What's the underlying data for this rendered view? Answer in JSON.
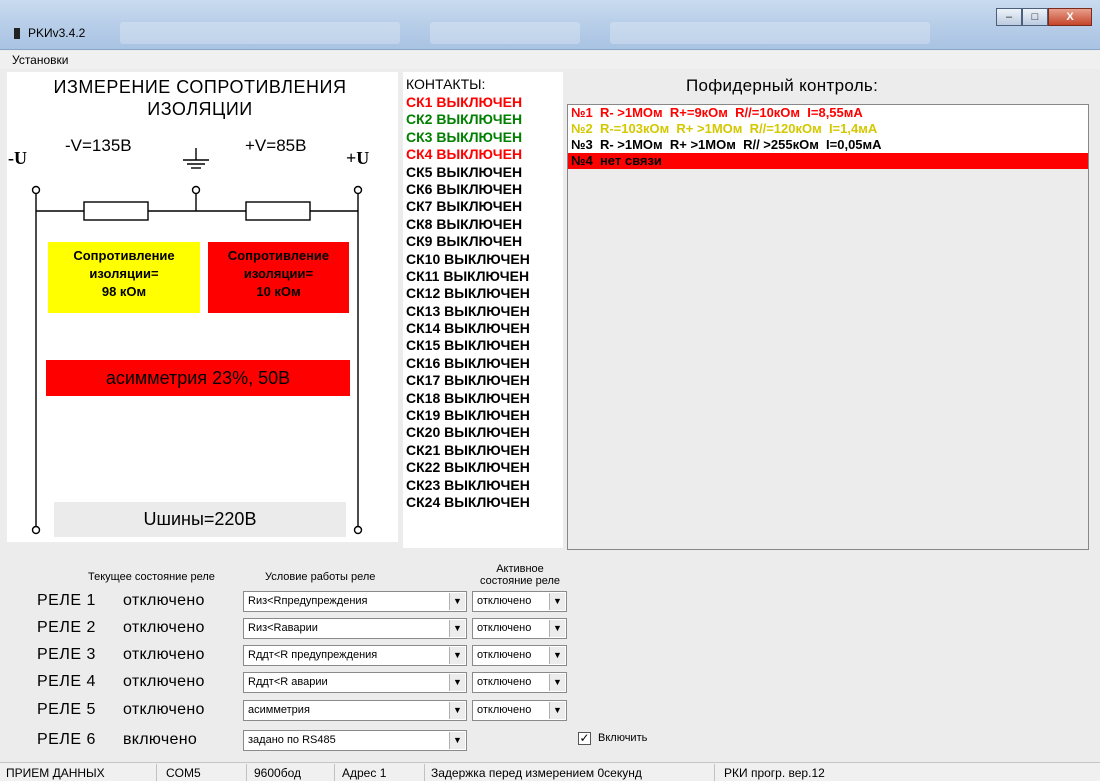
{
  "window": {
    "title": "PKИv3.4.2",
    "buttons": [
      "–",
      "□",
      "X"
    ]
  },
  "menu": {
    "settings": "Установки"
  },
  "insulation": {
    "title_line1": "ИЗМЕРЕНИЕ СОПРОТИВЛЕНИЯ",
    "title_line2": "ИЗОЛЯЦИИ",
    "v_minus": "-V=135B",
    "v_plus": "+V=85B",
    "u_minus": "-U",
    "u_plus": "+U",
    "res_left": [
      "Сопротивление",
      "изоляции=",
      "98 кОм"
    ],
    "res_right": [
      "Сопротивление",
      "изоляции=",
      "10 кОм"
    ],
    "asymmetry": "асимметрия  23%, 50В",
    "bus_voltage": "Uшины=220В",
    "colors": {
      "warning": "#ffff00",
      "alarm": "#ff0000"
    }
  },
  "contacts": {
    "header": "КОНТАКТЫ:",
    "items": [
      {
        "label": "СК1 ВЫКЛЮЧЕН",
        "color": "#ff0000"
      },
      {
        "label": "СК2 ВЫКЛЮЧЕН",
        "color": "#008000"
      },
      {
        "label": "СК3 ВЫКЛЮЧЕН",
        "color": "#008000"
      },
      {
        "label": "СК4 ВЫКЛЮЧЕН",
        "color": "#ff0000"
      },
      {
        "label": "СК5 ВЫКЛЮЧЕН",
        "color": "#000000"
      },
      {
        "label": "СК6 ВЫКЛЮЧЕН",
        "color": "#000000"
      },
      {
        "label": "СК7 ВЫКЛЮЧЕН",
        "color": "#000000"
      },
      {
        "label": "СК8 ВЫКЛЮЧЕН",
        "color": "#000000"
      },
      {
        "label": "СК9 ВЫКЛЮЧЕН",
        "color": "#000000"
      },
      {
        "label": "СК10 ВЫКЛЮЧЕН",
        "color": "#000000"
      },
      {
        "label": "СК11 ВЫКЛЮЧЕН",
        "color": "#000000"
      },
      {
        "label": "СК12 ВЫКЛЮЧЕН",
        "color": "#000000"
      },
      {
        "label": "СК13 ВЫКЛЮЧЕН",
        "color": "#000000"
      },
      {
        "label": "СК14 ВЫКЛЮЧЕН",
        "color": "#000000"
      },
      {
        "label": "СК15 ВЫКЛЮЧЕН",
        "color": "#000000"
      },
      {
        "label": "СК16 ВЫКЛЮЧЕН",
        "color": "#000000"
      },
      {
        "label": "СК17 ВЫКЛЮЧЕН",
        "color": "#000000"
      },
      {
        "label": "СК18 ВЫКЛЮЧЕН",
        "color": "#000000"
      },
      {
        "label": "СК19 ВЫКЛЮЧЕН",
        "color": "#000000"
      },
      {
        "label": "СК20 ВЫКЛЮЧЕН",
        "color": "#000000"
      },
      {
        "label": "СК21 ВЫКЛЮЧЕН",
        "color": "#000000"
      },
      {
        "label": "СК22 ВЫКЛЮЧЕН",
        "color": "#000000"
      },
      {
        "label": "СК23 ВЫКЛЮЧЕН",
        "color": "#000000"
      },
      {
        "label": "СК24 ВЫКЛЮЧЕН",
        "color": "#000000"
      }
    ]
  },
  "feeders": {
    "header": "Пофидерный контроль:",
    "items": [
      {
        "text": "№1  R- >1MOм  R+=9кОм  R//=10кОм  I=8,55мA",
        "color": "#ff0000",
        "bg": "#ffffff"
      },
      {
        "text": "№2  R-=103кОм  R+ >1MOм  R//=120кОм  I=1,4мA",
        "color": "#d4c800",
        "bg": "#ffffff"
      },
      {
        "text": "№3  R- >1MOм  R+ >1MOм  R// >255кОм  I=0,05мA",
        "color": "#000000",
        "bg": "#ffffff"
      },
      {
        "text": "№4  нет связи",
        "color": "#000000",
        "bg": "#ff0000"
      }
    ]
  },
  "relays": {
    "hdr_state": "Текущее состояние реле",
    "hdr_condition": "Условие работы реле",
    "hdr_active": "Активное состояние реле",
    "items": [
      {
        "name": "РЕЛЕ 1",
        "state": "отключено",
        "condition": "Rиз<Rпредупреждения",
        "active": "отключено"
      },
      {
        "name": "РЕЛЕ 2",
        "state": "отключено",
        "condition": "Rиз<Rаварии",
        "active": "отключено"
      },
      {
        "name": "РЕЛЕ 3",
        "state": "отключено",
        "condition": "Rддт<R предупреждения",
        "active": "отключено"
      },
      {
        "name": "РЕЛЕ 4",
        "state": "отключено",
        "condition": "Rддт<R аварии",
        "active": "отключено"
      },
      {
        "name": "РЕЛЕ 5",
        "state": "отключено",
        "condition": "асимметрия",
        "active": "отключено"
      },
      {
        "name": "РЕЛЕ 6",
        "state": "включено",
        "condition": "задано по RS485",
        "active": null
      }
    ],
    "enable_label": "Включить",
    "enable_checked": true,
    "check_glyph": "✓"
  },
  "status": {
    "receive": "ПРИЕМ ДАННЫХ",
    "port": "COM5",
    "baud": "9600бод",
    "address": "Адрес 1",
    "delay": "Задержка перед измерением 0секунд",
    "version": "РКИ прогр. вер.12"
  }
}
